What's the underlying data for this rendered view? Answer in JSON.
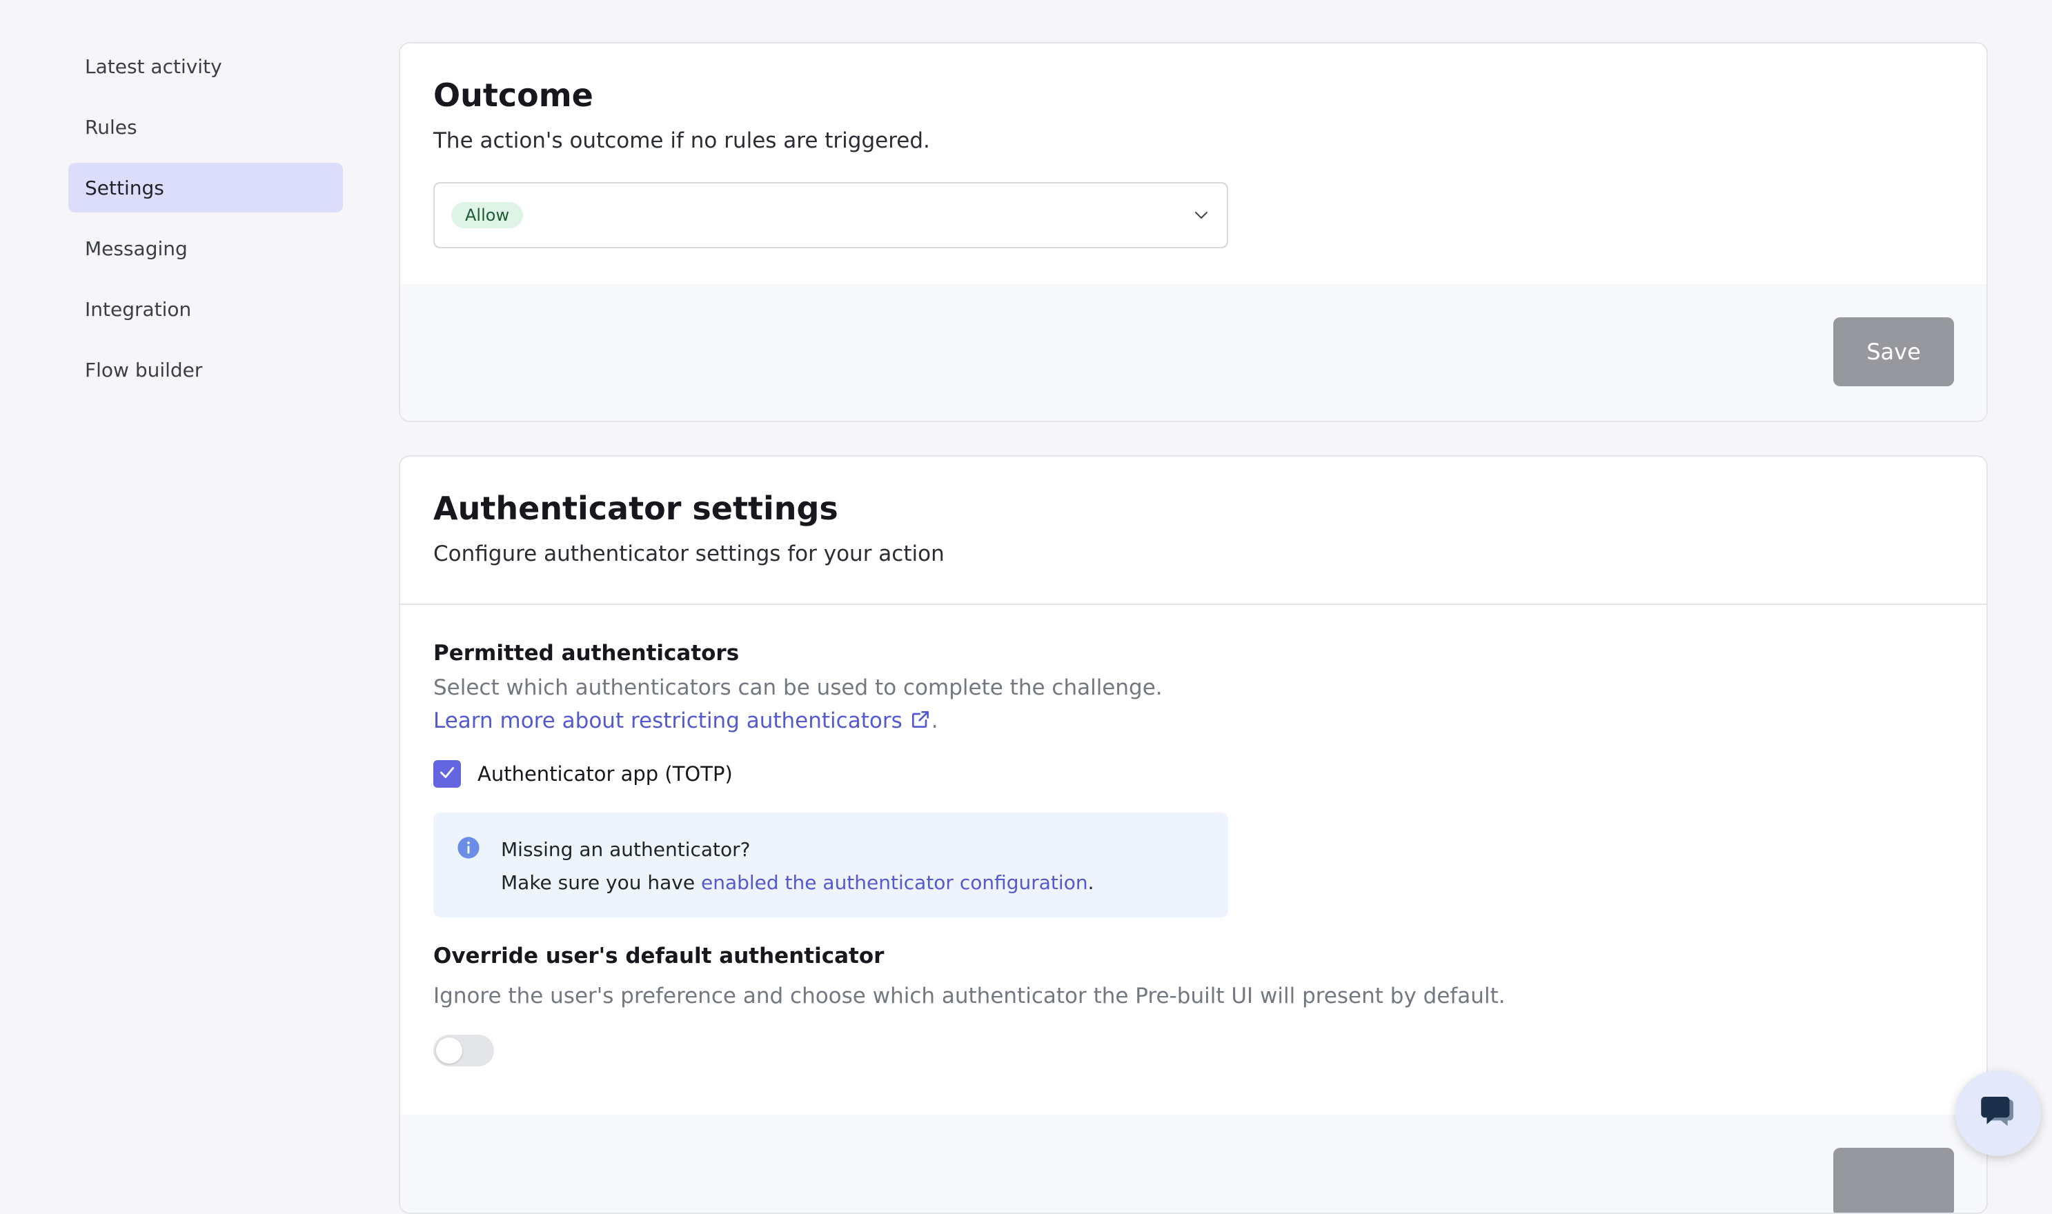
{
  "sidebar": {
    "items": [
      {
        "label": "Latest activity",
        "active": false
      },
      {
        "label": "Rules",
        "active": false
      },
      {
        "label": "Settings",
        "active": true
      },
      {
        "label": "Messaging",
        "active": false
      },
      {
        "label": "Integration",
        "active": false
      },
      {
        "label": "Flow builder",
        "active": false
      }
    ]
  },
  "outcome": {
    "title": "Outcome",
    "subtitle": "The action's outcome if no rules are triggered.",
    "selected_value": "Allow",
    "save_label": "Save"
  },
  "authenticator": {
    "title": "Authenticator settings",
    "subtitle": "Configure authenticator settings for your action",
    "permitted": {
      "title": "Permitted authenticators",
      "description": "Select which authenticators can be used to complete the challenge.",
      "learn_more_link": "Learn more about restricting authenticators",
      "learn_more_suffix": ".",
      "checkbox_label": "Authenticator app (TOTP)",
      "checkbox_checked": true
    },
    "info": {
      "title": "Missing an authenticator?",
      "body_prefix": "Make sure you have ",
      "body_link": "enabled the authenticator configuration",
      "body_suffix": "."
    },
    "override": {
      "title": "Override user's default authenticator",
      "description": "Ignore the user's preference and choose which authenticator the Pre-built UI will present by default.",
      "toggle_on": false
    }
  },
  "colors": {
    "accent": "#6366e0",
    "link": "#5459cf",
    "active_nav": "#dcddfb",
    "allow_pill_bg": "#dff3e6",
    "save_disabled": "#97989d",
    "info_bg": "#eef4fb"
  },
  "icons": {
    "select_caret": "chevron-down-icon",
    "external_link": "external-link-icon",
    "checkbox": "check-icon",
    "info": "info-icon",
    "chat": "chat-bubble-icon"
  }
}
